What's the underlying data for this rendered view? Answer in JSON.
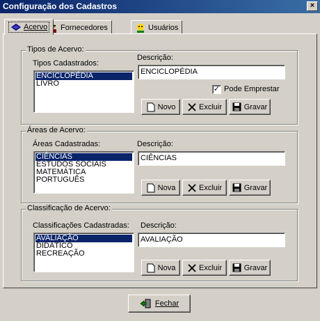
{
  "window": {
    "title": "Configuração dos Cadastros",
    "close_glyph": "×"
  },
  "tabs": [
    {
      "label": "Acervo",
      "icon": "book-icon",
      "active": true
    },
    {
      "label": "Fornecedores",
      "icon": "supplier-icon",
      "active": false
    },
    {
      "label": "Usuários",
      "icon": "user-icon",
      "active": false
    }
  ],
  "tipos": {
    "group_title": "Tipos de Acervo:",
    "list_label": "Tipos Cadastrados:",
    "items": [
      "ENCICLOPÉDIA",
      "LIVRO"
    ],
    "selected_index": 0,
    "desc_label": "Descrição:",
    "desc_value": "ENCICLOPÉDIA",
    "checkbox_label": "Pode Emprestar",
    "checkbox_checked": true,
    "btn_new": "Novo",
    "btn_delete": "Excluir",
    "btn_save": "Gravar"
  },
  "areas": {
    "group_title": "Áreas de Acervo:",
    "list_label": "Áreas Cadastradas:",
    "items": [
      "CIÊNCIAS",
      "ESTUDOS SOCIAIS",
      "MATEMÁTICA",
      "PORTUGUÊS"
    ],
    "selected_index": 0,
    "desc_label": "Descrição:",
    "desc_value": "CIÊNCIAS",
    "btn_new": "Nova",
    "btn_delete": "Excluir",
    "btn_save": "Gravar"
  },
  "classificacao": {
    "group_title": "Classificação de Acervo:",
    "list_label": "Classificações Cadastradas:",
    "items": [
      "AVALIAÇÃO",
      "DIDÁTICO",
      "RECREAÇÃO"
    ],
    "selected_index": 0,
    "desc_label": "Descrição:",
    "desc_value": "AVALIAÇÃO",
    "btn_new": "Nova",
    "btn_delete": "Excluir",
    "btn_save": "Gravar"
  },
  "footer": {
    "close_label": "Fechar"
  },
  "colors": {
    "title_bar": "#0a246a",
    "selection": "#0a246a",
    "face": "#d4d0c8"
  }
}
